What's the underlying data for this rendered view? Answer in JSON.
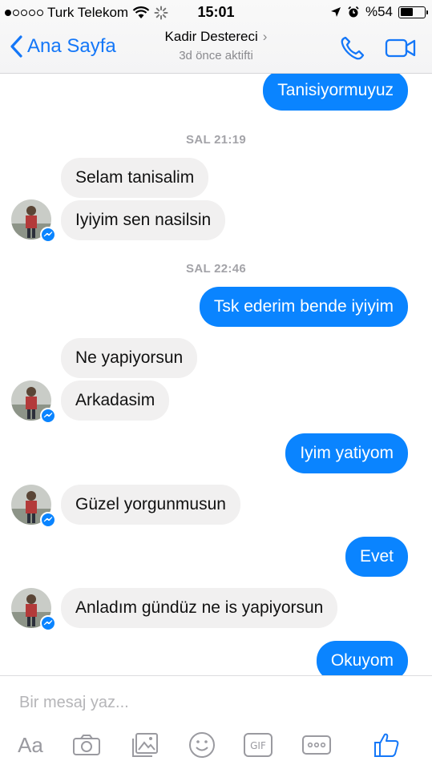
{
  "status": {
    "carrier": "Turk Telekom",
    "time": "15:01",
    "battery": "%54",
    "battery_level": 0.54
  },
  "nav": {
    "back_label": "Ana Sayfa",
    "contact_name": "Kadir Destereci",
    "subtitle": "3d önce aktifti"
  },
  "messages": [
    {
      "type": "out",
      "text": "Tanisiyormuyuz"
    },
    {
      "type": "stamp",
      "text": "SAL 21:19"
    },
    {
      "type": "in",
      "text": "Selam tanisalim"
    },
    {
      "type": "in",
      "text": "Iyiyim sen nasilsin"
    },
    {
      "type": "stamp",
      "text": "SAL 22:46"
    },
    {
      "type": "out",
      "text": "Tsk ederim bende iyiyim"
    },
    {
      "type": "in",
      "text": "Ne yapiyorsun"
    },
    {
      "type": "in",
      "text": "Arkadasim"
    },
    {
      "type": "out",
      "text": "Iyim yatiyom"
    },
    {
      "type": "in",
      "text": "Güzel yorgunmusun"
    },
    {
      "type": "out",
      "text": "Evet"
    },
    {
      "type": "in",
      "text": "Anladım gündüz ne is yapiyorsun"
    },
    {
      "type": "out",
      "text": "Okuyom"
    }
  ],
  "composer": {
    "placeholder": "Bir mesaj yaz...",
    "aa_label": "Aa",
    "gif_label": "GIF"
  },
  "colors": {
    "accent": "#1477f8",
    "outgoing_bubble": "#0a84ff",
    "incoming_bubble": "#f1f0f0"
  }
}
